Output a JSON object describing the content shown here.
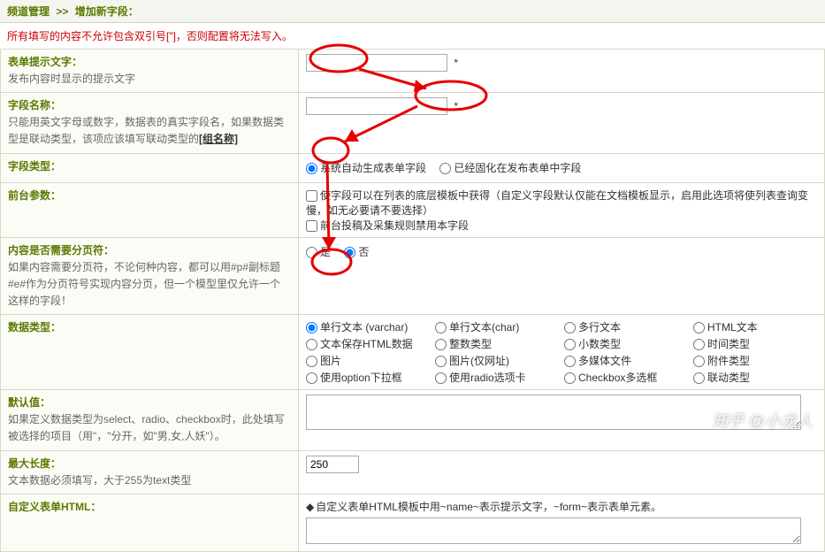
{
  "breadcrumb": {
    "a": "频道管理",
    "sep": ">>",
    "b": "增加新字段",
    "tail": "："
  },
  "warning": "所有填写的内容不允许包含双引号[\"]，否则配置将无法写入。",
  "rows": {
    "formtip": {
      "label": "表单提示文字：",
      "desc": "发布内容时显示的提示文字",
      "star": "*"
    },
    "fieldname": {
      "label": "字段名称：",
      "desc": "只能用英文字母或数字，数据表的真实字段名，如果数据类型是联动类型，该项应该填写联动类型的",
      "link": "[组名称]",
      "star": "*"
    },
    "fieldtype": {
      "label": "字段类型：",
      "opt1": "系统自动生成表单字段",
      "opt2": "已经固化在发布表单中字段"
    },
    "frontparam": {
      "label": "前台参数：",
      "chk1": "使字段可以在列表的底层模板中获得（自定义字段默认仅能在文档模板显示，启用此选项将使列表查询变慢，如无必要请不要选择）",
      "chk2": "前台投稿及采集规则禁用本字段"
    },
    "needpage": {
      "label": "内容是否需要分页符：",
      "desc": "如果内容需要分页符，不论何种内容，都可以用#p#副标题#e#作为分页符号实现内容分页，但一个模型里仅允许一个这样的字段！",
      "yes": "是",
      "no": "否"
    },
    "datatype": {
      "label": "数据类型：",
      "options": [
        "单行文本 (varchar)",
        "单行文本(char)",
        "多行文本",
        "HTML文本",
        "文本保存HTML数据",
        "整数类型",
        "小数类型",
        "时间类型",
        "图片",
        "图片(仅网址)",
        "多媒体文件",
        "附件类型",
        "使用option下拉框",
        "使用radio选项卡",
        "Checkbox多选框",
        "联动类型"
      ]
    },
    "defaultval": {
      "label": "默认值：",
      "desc": "如果定义数据类型为select、radio、checkbox时，此处填写被选择的项目（用\"，\"分开，如\"男,女,人妖\"）。"
    },
    "maxlen": {
      "label": "最大长度：",
      "desc": "文本数据必须填写，大于255为text类型",
      "value": "250"
    },
    "customhtml": {
      "label": "自定义表单HTML：",
      "hint_prefix": "◆",
      "hint": "自定义表单HTML模板中用~name~表示提示文字，~form~表示表单元素。"
    }
  },
  "watermark": "知乎 @小龙人",
  "chart_data": {
    "type": "table",
    "note": "No chart; admin form fields listed in rows above."
  }
}
